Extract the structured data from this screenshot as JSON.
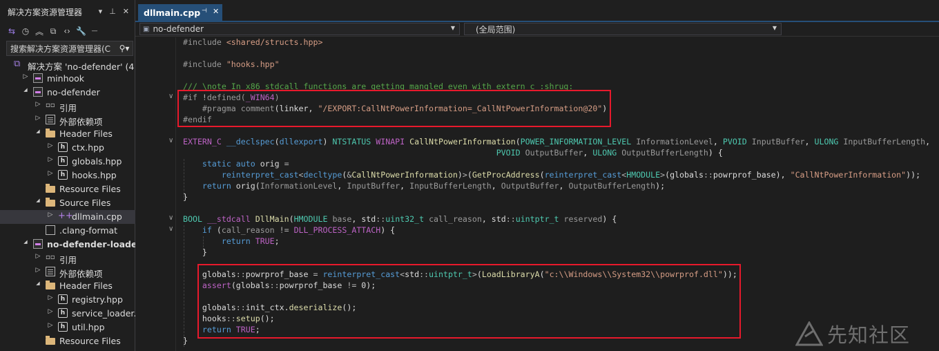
{
  "explorer": {
    "title": "解决方案资源管理器",
    "search_placeholder": "搜索解决方案资源管理器(C",
    "tree": [
      {
        "label": "解决方案 'no-defender' (4",
        "icon": "solution-icon",
        "level": 0,
        "arrow": ""
      },
      {
        "label": "minhook",
        "icon": "project-icon",
        "level": 1,
        "arrow": "collapsed"
      },
      {
        "label": "no-defender",
        "icon": "project-icon",
        "level": 1,
        "arrow": "expanded"
      },
      {
        "label": "引用",
        "icon": "references-icon",
        "level": 2,
        "arrow": "collapsed"
      },
      {
        "label": "外部依赖项",
        "icon": "external-deps-icon",
        "level": 2,
        "arrow": "collapsed"
      },
      {
        "label": "Header Files",
        "icon": "folder-icon",
        "level": 2,
        "arrow": "expanded"
      },
      {
        "label": "ctx.hpp",
        "icon": "header-file-icon",
        "level": 3,
        "arrow": "collapsed"
      },
      {
        "label": "globals.hpp",
        "icon": "header-file-icon",
        "level": 3,
        "arrow": "collapsed"
      },
      {
        "label": "hooks.hpp",
        "icon": "header-file-icon",
        "level": 3,
        "arrow": "collapsed"
      },
      {
        "label": "Resource Files",
        "icon": "folder-icon",
        "level": 2,
        "arrow": ""
      },
      {
        "label": "Source Files",
        "icon": "folder-icon",
        "level": 2,
        "arrow": "expanded"
      },
      {
        "label": "dllmain.cpp",
        "icon": "cpp-file-icon",
        "level": 3,
        "arrow": "collapsed",
        "selected": true
      },
      {
        "label": ".clang-format",
        "icon": "file-icon",
        "level": 2,
        "arrow": ""
      },
      {
        "label": "no-defender-loader",
        "icon": "project-icon",
        "level": 1,
        "arrow": "expanded",
        "bold": true
      },
      {
        "label": "引用",
        "icon": "references-icon",
        "level": 2,
        "arrow": "collapsed"
      },
      {
        "label": "外部依赖项",
        "icon": "external-deps-icon",
        "level": 2,
        "arrow": "collapsed"
      },
      {
        "label": "Header Files",
        "icon": "folder-icon",
        "level": 2,
        "arrow": "expanded"
      },
      {
        "label": "registry.hpp",
        "icon": "header-file-icon",
        "level": 3,
        "arrow": "collapsed"
      },
      {
        "label": "service_loader.hpp",
        "icon": "header-file-icon",
        "level": 3,
        "arrow": "collapsed"
      },
      {
        "label": "util.hpp",
        "icon": "header-file-icon",
        "level": 3,
        "arrow": "collapsed"
      },
      {
        "label": "Resource Files",
        "icon": "folder-icon",
        "level": 2,
        "arrow": ""
      }
    ]
  },
  "editor": {
    "tab_label": "dllmain.cpp",
    "project_dropdown": "no-defender",
    "scope_dropdown": "(全局范围)",
    "code_lines": [
      [
        [
          "pp",
          "#include "
        ],
        [
          "str",
          "<shared/structs.hpp>"
        ]
      ],
      [],
      [
        [
          "pp",
          "#include "
        ],
        [
          "str",
          "\"hooks.hpp\""
        ]
      ],
      [],
      [
        [
          "cm",
          "/// \\note In x86 stdcall functions are getting mangled even with extern c :shrug:"
        ]
      ],
      [
        [
          "pp",
          "#if "
        ],
        [
          "op",
          "!"
        ],
        [
          "pp",
          "defined("
        ],
        [
          "mac",
          "_WIN64"
        ],
        [
          "pp",
          ")"
        ]
      ],
      [
        [
          "var",
          "    "
        ],
        [
          "pp",
          "#pragma comment"
        ],
        [
          "var",
          "(linker, "
        ],
        [
          "str",
          "\"/EXPORT:CallNtPowerInformation=_CallNtPowerInformation@20\""
        ],
        [
          "var",
          ")"
        ]
      ],
      [
        [
          "pp",
          "#endif"
        ]
      ],
      [],
      [
        [
          "mac",
          "EXTERN_C"
        ],
        [
          "var",
          " "
        ],
        [
          "kw",
          "__declspec"
        ],
        [
          "var",
          "("
        ],
        [
          "kw",
          "dllexport"
        ],
        [
          "var",
          ") "
        ],
        [
          "ty",
          "NTSTATUS"
        ],
        [
          "var",
          " "
        ],
        [
          "mac",
          "WINAPI"
        ],
        [
          "var",
          " "
        ],
        [
          "fn",
          "CallNtPowerInformation"
        ],
        [
          "var",
          "("
        ],
        [
          "ty",
          "POWER_INFORMATION_LEVEL"
        ],
        [
          "var",
          " "
        ],
        [
          "prm",
          "InformationLevel"
        ],
        [
          "var",
          ", "
        ],
        [
          "ty",
          "PVOID"
        ],
        [
          "var",
          " "
        ],
        [
          "prm",
          "InputBuffer"
        ],
        [
          "var",
          ", "
        ],
        [
          "ty",
          "ULONG"
        ],
        [
          "var",
          " "
        ],
        [
          "prm",
          "InputBufferLength"
        ],
        [
          "var",
          ","
        ]
      ],
      [
        [
          "var",
          "                                                                 "
        ],
        [
          "ty",
          "PVOID"
        ],
        [
          "var",
          " "
        ],
        [
          "prm",
          "OutputBuffer"
        ],
        [
          "var",
          ", "
        ],
        [
          "ty",
          "ULONG"
        ],
        [
          "var",
          " "
        ],
        [
          "prm",
          "OutputBufferLength"
        ],
        [
          "var",
          ") {"
        ]
      ],
      [
        [
          "var",
          "    "
        ],
        [
          "kw",
          "static"
        ],
        [
          "var",
          " "
        ],
        [
          "kw",
          "auto"
        ],
        [
          "var",
          " orig "
        ],
        [
          "op",
          "="
        ]
      ],
      [
        [
          "var",
          "        "
        ],
        [
          "kw",
          "reinterpret_cast"
        ],
        [
          "op",
          "<"
        ],
        [
          "kw",
          "decltype"
        ],
        [
          "var",
          "("
        ],
        [
          "op",
          "&"
        ],
        [
          "fn",
          "CallNtPowerInformation"
        ],
        [
          "var",
          ")"
        ],
        [
          "op",
          ">"
        ],
        [
          "var",
          "("
        ],
        [
          "fn",
          "GetProcAddress"
        ],
        [
          "var",
          "("
        ],
        [
          "kw",
          "reinterpret_cast"
        ],
        [
          "op",
          "<"
        ],
        [
          "ty",
          "HMODULE"
        ],
        [
          "op",
          ">"
        ],
        [
          "var",
          "(globals"
        ],
        [
          "op",
          "::"
        ],
        [
          "var",
          "powrprof_base), "
        ],
        [
          "str",
          "\"CallNtPowerInformation\""
        ],
        [
          "var",
          "));"
        ]
      ],
      [
        [
          "var",
          "    "
        ],
        [
          "kw",
          "return"
        ],
        [
          "var",
          " orig("
        ],
        [
          "prm",
          "InformationLevel"
        ],
        [
          "var",
          ", "
        ],
        [
          "prm",
          "InputBuffer"
        ],
        [
          "var",
          ", "
        ],
        [
          "prm",
          "InputBufferLength"
        ],
        [
          "var",
          ", "
        ],
        [
          "prm",
          "OutputBuffer"
        ],
        [
          "var",
          ", "
        ],
        [
          "prm",
          "OutputBufferLength"
        ],
        [
          "var",
          ");"
        ]
      ],
      [
        [
          "var",
          "}"
        ]
      ],
      [],
      [
        [
          "ty",
          "BOOL"
        ],
        [
          "var",
          " "
        ],
        [
          "mac",
          "__stdcall"
        ],
        [
          "var",
          " "
        ],
        [
          "fn",
          "DllMain"
        ],
        [
          "var",
          "("
        ],
        [
          "ty",
          "HMODULE"
        ],
        [
          "var",
          " "
        ],
        [
          "prm",
          "base"
        ],
        [
          "var",
          ", std"
        ],
        [
          "op",
          "::"
        ],
        [
          "ty",
          "uint32_t"
        ],
        [
          "var",
          " "
        ],
        [
          "prm",
          "call_reason"
        ],
        [
          "var",
          ", std"
        ],
        [
          "op",
          "::"
        ],
        [
          "ty",
          "uintptr_t"
        ],
        [
          "var",
          " "
        ],
        [
          "prm",
          "reserved"
        ],
        [
          "var",
          ") {"
        ]
      ],
      [
        [
          "var",
          "    "
        ],
        [
          "kw",
          "if"
        ],
        [
          "var",
          " ("
        ],
        [
          "prm",
          "call_reason"
        ],
        [
          "var",
          " "
        ],
        [
          "op",
          "!="
        ],
        [
          "var",
          " "
        ],
        [
          "mac",
          "DLL_PROCESS_ATTACH"
        ],
        [
          "var",
          ") {"
        ]
      ],
      [
        [
          "var",
          "        "
        ],
        [
          "kw",
          "return"
        ],
        [
          "var",
          " "
        ],
        [
          "mac",
          "TRUE"
        ],
        [
          "var",
          ";"
        ]
      ],
      [
        [
          "var",
          "    }"
        ]
      ],
      [],
      [
        [
          "var",
          "    globals"
        ],
        [
          "op",
          "::"
        ],
        [
          "var",
          "powrprof_base "
        ],
        [
          "op",
          "="
        ],
        [
          "var",
          " "
        ],
        [
          "kw",
          "reinterpret_cast"
        ],
        [
          "op",
          "<"
        ],
        [
          "var",
          "std"
        ],
        [
          "op",
          "::"
        ],
        [
          "ty",
          "uintptr_t"
        ],
        [
          "op",
          ">"
        ],
        [
          "var",
          "("
        ],
        [
          "fn",
          "LoadLibraryA"
        ],
        [
          "var",
          "("
        ],
        [
          "str",
          "\"c:\\\\Windows\\\\System32\\\\powrprof.dll\""
        ],
        [
          "var",
          "));"
        ]
      ],
      [
        [
          "var",
          "    "
        ],
        [
          "mac",
          "assert"
        ],
        [
          "var",
          "(globals"
        ],
        [
          "op",
          "::"
        ],
        [
          "var",
          "powrprof_base "
        ],
        [
          "op",
          "!="
        ],
        [
          "var",
          " 0);"
        ]
      ],
      [],
      [
        [
          "var",
          "    globals"
        ],
        [
          "op",
          "::"
        ],
        [
          "var",
          "init_ctx."
        ],
        [
          "fn",
          "deserialize"
        ],
        [
          "var",
          "();"
        ]
      ],
      [
        [
          "var",
          "    hooks"
        ],
        [
          "op",
          "::"
        ],
        [
          "fn",
          "setup"
        ],
        [
          "var",
          "();"
        ]
      ],
      [
        [
          "var",
          "    "
        ],
        [
          "kw",
          "return"
        ],
        [
          "var",
          " "
        ],
        [
          "mac",
          "TRUE"
        ],
        [
          "var",
          ";"
        ]
      ],
      [
        [
          "var",
          "}"
        ]
      ]
    ]
  },
  "watermark": {
    "text": "先知社区"
  }
}
